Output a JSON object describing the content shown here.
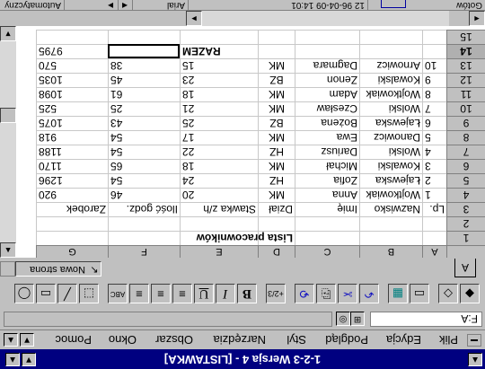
{
  "window": {
    "title": "1-2-3 Wersja 4 - [LISTAWKA]",
    "controls": [
      "▼",
      "▲",
      "▲"
    ]
  },
  "menu": {
    "items": [
      "Plik",
      "Edycja",
      "Podgląd",
      "Styl",
      "Narzędzia",
      "Obszar",
      "Okno",
      "Pomoc"
    ],
    "mdi_controls": [
      "▲",
      "▼"
    ]
  },
  "address": {
    "cell_ref": "F:A",
    "icons": [
      "⊞",
      "◎"
    ]
  },
  "toolbar": {
    "buttons": [
      "◆",
      "◇",
      "▭",
      "▦",
      "↶",
      "✂",
      "⎘",
      "⟲",
      "+2/3",
      "B",
      "I",
      "U",
      "≡",
      "≡",
      "≡",
      "ABC",
      "⬚",
      "╱",
      "▭",
      "◯"
    ]
  },
  "sheet": {
    "tab": "A",
    "new_sheet": "Nowa strona",
    "new_sheet_icon": "↖"
  },
  "columns": [
    "A",
    "B",
    "C",
    "D",
    "E",
    "F",
    "G"
  ],
  "rows": [
    {
      "num": "1",
      "cells": [
        "",
        "",
        "",
        "Lista pracowników",
        "",
        "",
        ""
      ]
    },
    {
      "num": "2",
      "cells": [
        "",
        "",
        "",
        "",
        "",
        "",
        ""
      ]
    },
    {
      "num": "3",
      "cells": [
        "Lp.",
        "Nazwisko",
        "Imię",
        "Dział",
        "Stawka z/h",
        "Ilość godz.",
        "Zarobek"
      ]
    },
    {
      "num": "4",
      "cells": [
        "1",
        "Wojtkowiak",
        "Anna",
        "MK",
        "20",
        "46",
        "920"
      ]
    },
    {
      "num": "5",
      "cells": [
        "2",
        "Łajewska",
        "Zofia",
        "HZ",
        "24",
        "54",
        "1296"
      ]
    },
    {
      "num": "6",
      "cells": [
        "3",
        "Kowalski",
        "Michał",
        "MK",
        "18",
        "65",
        "1170"
      ]
    },
    {
      "num": "7",
      "cells": [
        "4",
        "Wolski",
        "Dariusz",
        "HZ",
        "22",
        "54",
        "1188"
      ]
    },
    {
      "num": "8",
      "cells": [
        "5",
        "Danowicz",
        "Ewa",
        "MK",
        "17",
        "54",
        "918"
      ]
    },
    {
      "num": "9",
      "cells": [
        "6",
        "Łajewska",
        "Bożena",
        "BZ",
        "25",
        "43",
        "1075"
      ]
    },
    {
      "num": "10",
      "cells": [
        "7",
        "Wolski",
        "Czesław",
        "MK",
        "21",
        "25",
        "525"
      ]
    },
    {
      "num": "11",
      "cells": [
        "8",
        "Wojtkowiak",
        "Adam",
        "MK",
        "18",
        "61",
        "1098"
      ]
    },
    {
      "num": "12",
      "cells": [
        "9",
        "Kowalski",
        "Zenon",
        "BZ",
        "23",
        "45",
        "1035"
      ]
    },
    {
      "num": "13",
      "cells": [
        "10",
        "Arnowicz",
        "Dagmara",
        "MK",
        "15",
        "38",
        "570"
      ]
    },
    {
      "num": "14",
      "cells": [
        "",
        "",
        "",
        "",
        "RAZEM",
        "",
        "9795"
      ]
    },
    {
      "num": "15",
      "cells": [
        "",
        "",
        "",
        "",
        "",
        "",
        ""
      ]
    }
  ],
  "status": {
    "mode": "Gotów",
    "time": "12  96-04-09 14:01",
    "font": "Arial",
    "automation": "Automatyczny",
    "arrows": [
      "◄",
      "►"
    ]
  },
  "colors": {
    "title_bar": "#000080",
    "chrome": "#c0c0c0",
    "icon_blue": "#1010c0"
  }
}
